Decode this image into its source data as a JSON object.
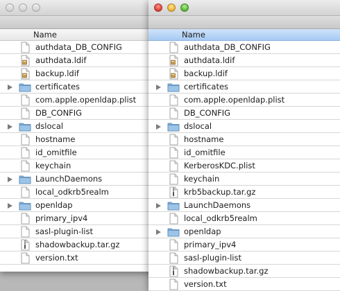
{
  "left_window": {
    "column_header": "Name",
    "items": [
      {
        "name": "authdata_DB_CONFIG",
        "kind": "document-icon",
        "expandable": false
      },
      {
        "name": "authdata.ldif",
        "kind": "ldif-icon",
        "expandable": false
      },
      {
        "name": "backup.ldif",
        "kind": "ldif-icon",
        "expandable": false
      },
      {
        "name": "certificates",
        "kind": "folder-icon",
        "expandable": true
      },
      {
        "name": "com.apple.openldap.plist",
        "kind": "document-icon",
        "expandable": false
      },
      {
        "name": "DB_CONFIG",
        "kind": "document-icon",
        "expandable": false
      },
      {
        "name": "dslocal",
        "kind": "folder-icon",
        "expandable": true
      },
      {
        "name": "hostname",
        "kind": "document-icon",
        "expandable": false
      },
      {
        "name": "id_omitfile",
        "kind": "document-icon",
        "expandable": false
      },
      {
        "name": "keychain",
        "kind": "document-icon",
        "expandable": false
      },
      {
        "name": "LaunchDaemons",
        "kind": "folder-icon",
        "expandable": true
      },
      {
        "name": "local_odkrb5realm",
        "kind": "document-icon",
        "expandable": false
      },
      {
        "name": "openldap",
        "kind": "folder-icon",
        "expandable": true
      },
      {
        "name": "primary_ipv4",
        "kind": "document-icon",
        "expandable": false
      },
      {
        "name": "sasl-plugin-list",
        "kind": "document-icon",
        "expandable": false
      },
      {
        "name": "shadowbackup.tar.gz",
        "kind": "archive-icon",
        "expandable": false
      },
      {
        "name": "version.txt",
        "kind": "document-icon",
        "expandable": false
      }
    ]
  },
  "right_window": {
    "column_header": "Name",
    "items": [
      {
        "name": "authdata_DB_CONFIG",
        "kind": "document-icon",
        "expandable": false
      },
      {
        "name": "authdata.ldif",
        "kind": "ldif-icon",
        "expandable": false
      },
      {
        "name": "backup.ldif",
        "kind": "ldif-icon",
        "expandable": false
      },
      {
        "name": "certificates",
        "kind": "folder-icon",
        "expandable": true
      },
      {
        "name": "com.apple.openldap.plist",
        "kind": "document-icon",
        "expandable": false
      },
      {
        "name": "DB_CONFIG",
        "kind": "document-icon",
        "expandable": false
      },
      {
        "name": "dslocal",
        "kind": "folder-icon",
        "expandable": true
      },
      {
        "name": "hostname",
        "kind": "document-icon",
        "expandable": false
      },
      {
        "name": "id_omitfile",
        "kind": "document-icon",
        "expandable": false
      },
      {
        "name": "KerberosKDC.plist",
        "kind": "document-icon",
        "expandable": false
      },
      {
        "name": "keychain",
        "kind": "document-icon",
        "expandable": false
      },
      {
        "name": "krb5backup.tar.gz",
        "kind": "archive-icon",
        "expandable": false
      },
      {
        "name": "LaunchDaemons",
        "kind": "folder-icon",
        "expandable": true
      },
      {
        "name": "local_odkrb5realm",
        "kind": "document-icon",
        "expandable": false
      },
      {
        "name": "openldap",
        "kind": "folder-icon",
        "expandable": true
      },
      {
        "name": "primary_ipv4",
        "kind": "document-icon",
        "expandable": false
      },
      {
        "name": "sasl-plugin-list",
        "kind": "document-icon",
        "expandable": false
      },
      {
        "name": "shadowbackup.tar.gz",
        "kind": "archive-icon",
        "expandable": false
      },
      {
        "name": "version.txt",
        "kind": "document-icon",
        "expandable": false
      }
    ]
  },
  "colors": {
    "folder": "#7fb0dc",
    "header_selected": "#a6caf3",
    "close_button": "#e0443a",
    "minimize_button": "#f1b93a",
    "zoom_button": "#5fbd3c"
  }
}
